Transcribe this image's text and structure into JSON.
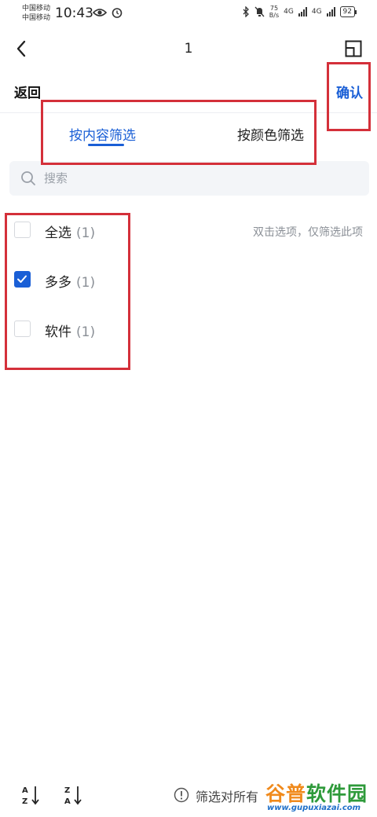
{
  "status_bar": {
    "carrier_1": "中国移动",
    "carrier_2": "中国移动",
    "time": "10:43",
    "net_speed_value": "75",
    "net_speed_unit": "B/s",
    "net_type_1": "4G",
    "net_type_2": "4G",
    "battery": "92"
  },
  "title_bar": {
    "title": "1",
    "back_icon": "chevron-left-icon",
    "window_icon": "window-resize-icon"
  },
  "action_row": {
    "back_label": "返回",
    "confirm_label": "确认"
  },
  "tabs": [
    {
      "label": "按内容筛选",
      "active": true
    },
    {
      "label": "按颜色筛选",
      "active": false
    }
  ],
  "search": {
    "placeholder": "搜索"
  },
  "options": [
    {
      "label": "全选",
      "count": "(1)",
      "checked": false
    },
    {
      "label": "多多",
      "count": "(1)",
      "checked": true
    },
    {
      "label": "软件",
      "count": "(1)",
      "checked": false
    }
  ],
  "hint": "双击选项，仅筛选此项",
  "bottom_bar": {
    "sort_asc_icon": "sort-a-to-z-icon",
    "sort_desc_icon": "sort-z-to-a-icon",
    "note": "筛选对所有"
  },
  "watermark": {
    "logo_part1": "谷普",
    "logo_part2": "软件园",
    "url": "www.gupuxiazai.com"
  },
  "colors": {
    "accent": "#1a5fd6",
    "annotation": "#d4303a"
  }
}
